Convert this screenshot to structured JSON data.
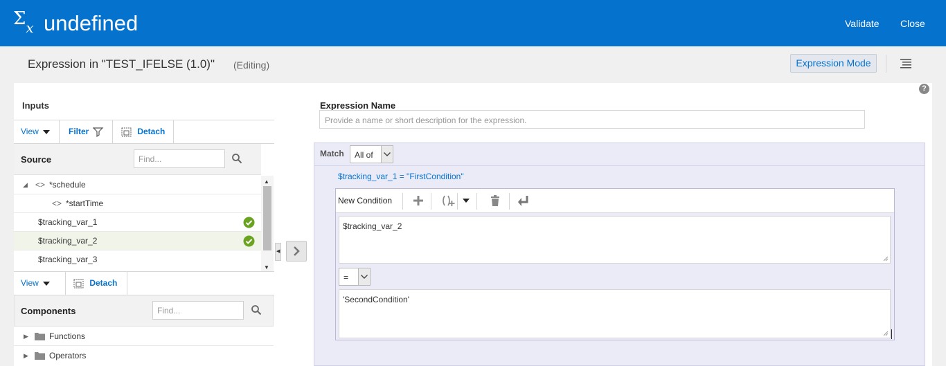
{
  "header": {
    "title": "undefined",
    "validate_label": "Validate",
    "close_label": "Close"
  },
  "subheader": {
    "heading": "Expression in \"TEST_IFELSE (1.0)\"",
    "status": "(Editing)",
    "mode_button": "Expression Mode"
  },
  "inputs": {
    "title": "Inputs",
    "view_label": "View",
    "filter_label": "Filter",
    "detach_label": "Detach",
    "source_label": "Source",
    "find_placeholder": "Find...",
    "tree": [
      {
        "label": "*schedule"
      },
      {
        "label": "*startTime"
      },
      {
        "label": "$tracking_var_1"
      },
      {
        "label": "$tracking_var_2"
      },
      {
        "label": "$tracking_var_3"
      }
    ]
  },
  "components": {
    "view_label": "View",
    "detach_label": "Detach",
    "title": "Components",
    "find_placeholder": "Find...",
    "items": [
      {
        "label": "Functions"
      },
      {
        "label": "Operators"
      }
    ]
  },
  "expression": {
    "name_label": "Expression Name",
    "name_placeholder": "Provide a name or short description for the expression.",
    "match_label": "Match",
    "match_value": "All of",
    "first_condition": "$tracking_var_1 = \"FirstCondition\"",
    "new_condition_label": "New Condition",
    "left_operand": "$tracking_var_2",
    "operator": "=",
    "right_operand": "'SecondCondition'"
  },
  "colors": {
    "header": "#0572ce",
    "match_bg": "#ebebf8",
    "check_green": "#6aa31f"
  }
}
